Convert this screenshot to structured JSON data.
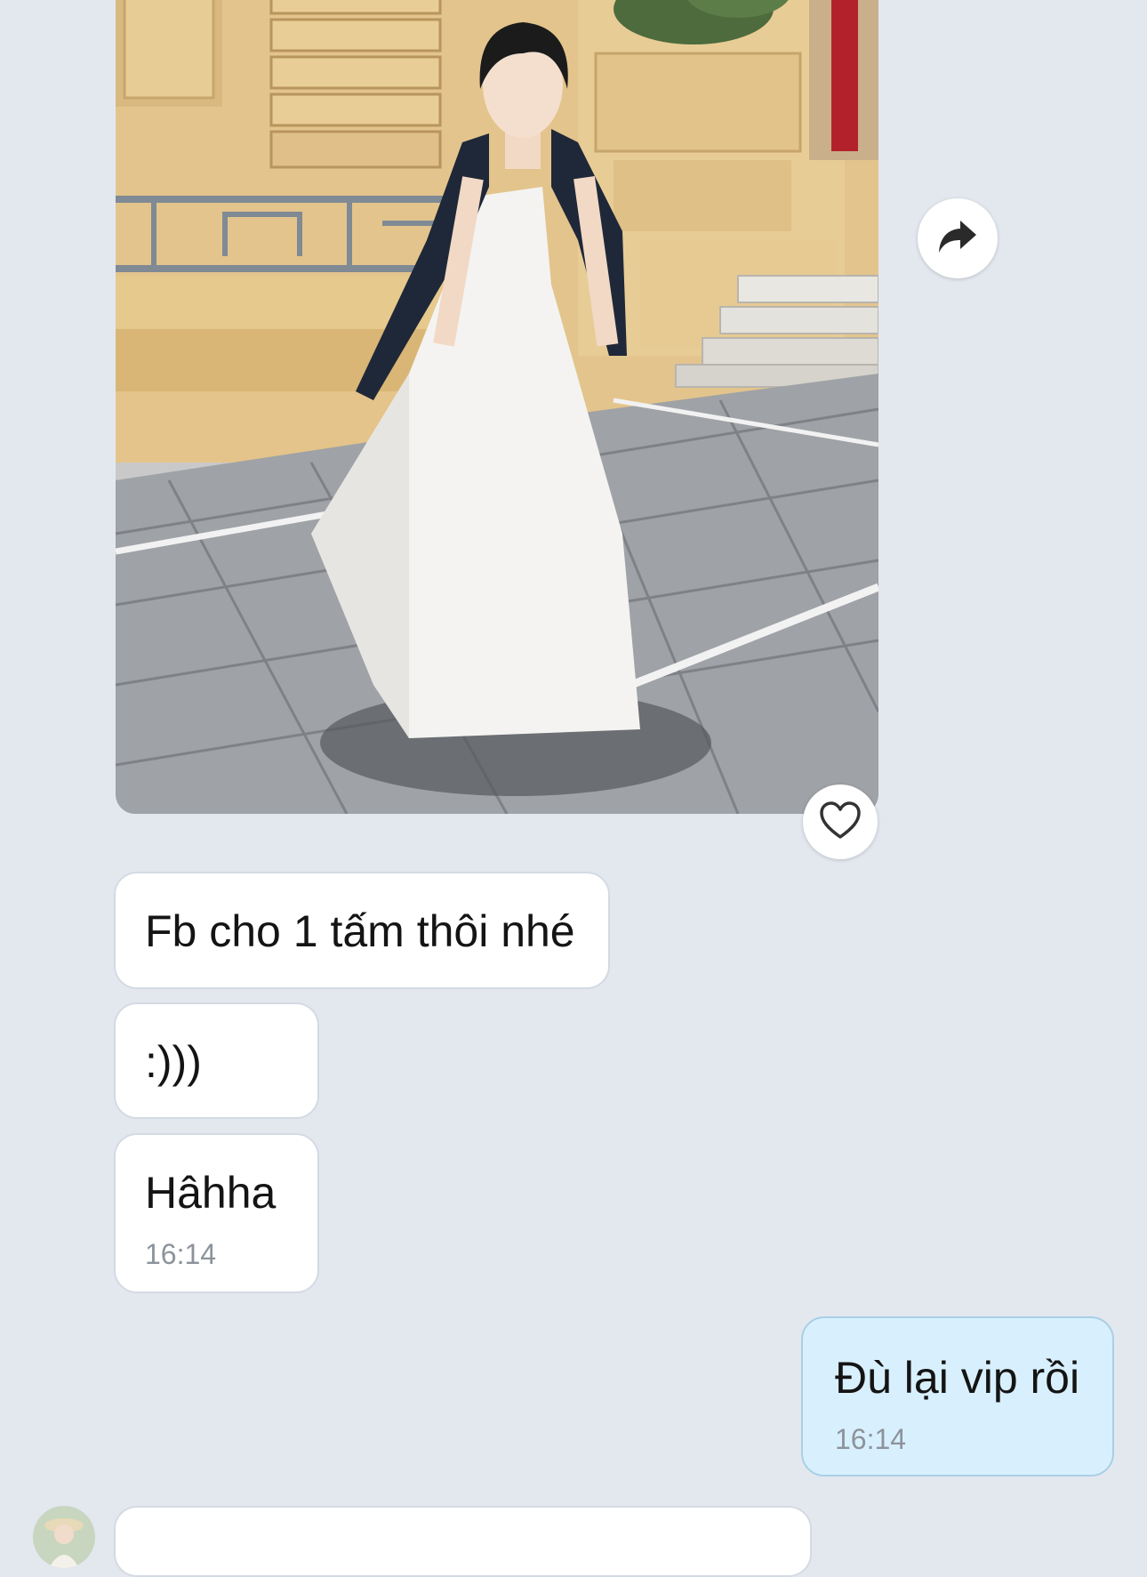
{
  "chat": {
    "messages": [
      {
        "id": "photo",
        "type": "image",
        "alt": "",
        "side": "incoming"
      },
      {
        "id": "m1",
        "text": "Fb cho 1 tấm thôi nhé",
        "side": "incoming"
      },
      {
        "id": "m2",
        "text": ":)))",
        "side": "incoming"
      },
      {
        "id": "m3",
        "text": "Hâhha",
        "time": "16:14",
        "side": "incoming"
      },
      {
        "id": "m4",
        "text": "Đù lại vip rồi",
        "time": "16:14",
        "side": "outgoing"
      }
    ]
  },
  "icons": {
    "share": "share-arrow-icon",
    "like": "heart-icon",
    "avatar": "contact-avatar"
  },
  "colors": {
    "background": "#e3e8ef",
    "incoming_bubble": "#ffffff",
    "outgoing_bubble": "#d8f0fd",
    "timestamp": "#8c939c"
  }
}
